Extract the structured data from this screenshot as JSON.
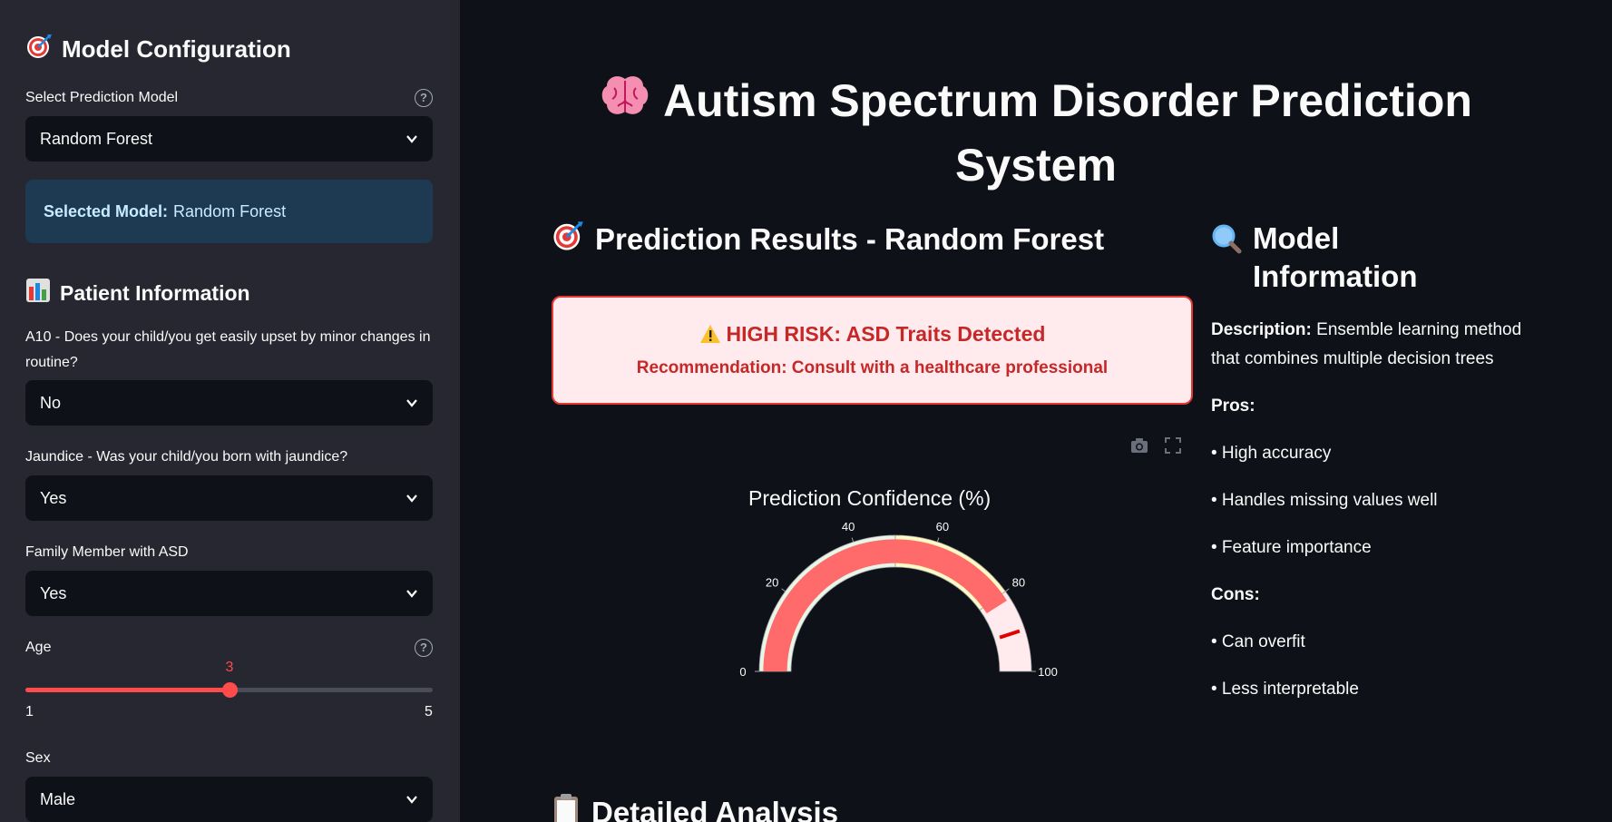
{
  "sidebar": {
    "model_config_title": "Model Configuration",
    "model_select_label": "Select Prediction Model",
    "model_select_value": "Random Forest",
    "selected_model_label": "Selected Model:",
    "selected_model_value": "Random Forest",
    "patient_info_title": "Patient Information",
    "a10_label": "A10 - Does your child/you get easily upset by minor changes in routine?",
    "a10_value": "No",
    "jaundice_label": "Jaundice - Was your child/you born with jaundice?",
    "jaundice_value": "Yes",
    "family_label": "Family Member with ASD",
    "family_value": "Yes",
    "age_label": "Age",
    "age_value": "3",
    "age_min": "1",
    "age_max": "5",
    "age_fraction": 0.5,
    "sex_label": "Sex",
    "sex_value": "Male"
  },
  "main": {
    "page_title": "Autism Spectrum Disorder Prediction System",
    "results_title": "Prediction Results - Random Forest",
    "alert_title": "HIGH RISK: ASD Traits Detected",
    "alert_recommendation": "Recommendation: Consult with a healthcare professional",
    "gauge_title": "Prediction Confidence (%)",
    "detailed_title": "Detailed Analysis"
  },
  "model_info": {
    "title": "Model Information",
    "description_label": "Description:",
    "description": "Ensemble learning method that combines multiple decision trees",
    "pros_label": "Pros:",
    "pros": [
      "• High accuracy",
      "• Handles missing values well",
      "• Feature importance"
    ],
    "cons_label": "Cons:",
    "cons": [
      "• Can overfit",
      "• Less interpretable"
    ]
  },
  "chart_data": {
    "type": "gauge",
    "title": "Prediction Confidence (%)",
    "value": 82,
    "range": [
      0,
      100
    ],
    "threshold": 90,
    "ticks": [
      0,
      20,
      40,
      60,
      80,
      100
    ],
    "steps": [
      {
        "range": [
          0,
          50
        ],
        "color": "#e8f5e9"
      },
      {
        "range": [
          50,
          80
        ],
        "color": "#fff9c4"
      },
      {
        "range": [
          80,
          100
        ],
        "color": "#ffebee"
      }
    ],
    "bar_color": "#ff6b6b",
    "threshold_color": "#e00000"
  },
  "colors": {
    "accent": "#ff4b4b",
    "alert_border": "#e53935",
    "alert_text": "#c62828"
  }
}
